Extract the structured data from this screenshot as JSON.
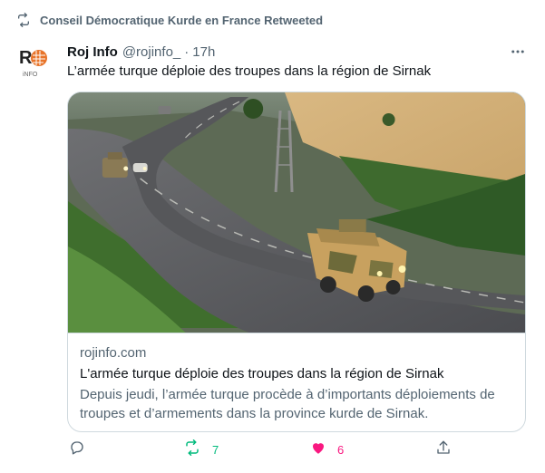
{
  "retweet_banner": {
    "text": "Conseil Démocratique Kurde en France Retweeted"
  },
  "tweet": {
    "author_name": "Roj Info",
    "author_handle": "@rojinfo_",
    "dot": "·",
    "time": "17h",
    "text": "L’armée turque déploie des troupes dans la région de Sirnak"
  },
  "card": {
    "domain": "rojinfo.com",
    "title": "L'armée turque déploie des troupes dans la région de Sirnak",
    "description": "Depuis jeudi, l’armée turque procède à d’importants déploiements de troupes et d’armements dans la province kurde de Sirnak."
  },
  "actions": {
    "reply_count": "",
    "retweet_count": "7",
    "like_count": "6"
  },
  "colors": {
    "retweet_green": "#00ba7c",
    "like_pink": "#f91880",
    "muted": "#536471",
    "avatar_orange": "#e8742a"
  },
  "icons": [
    "retweet-icon",
    "more-icon",
    "reply-icon",
    "retweet-icon",
    "heart-icon",
    "share-icon"
  ]
}
